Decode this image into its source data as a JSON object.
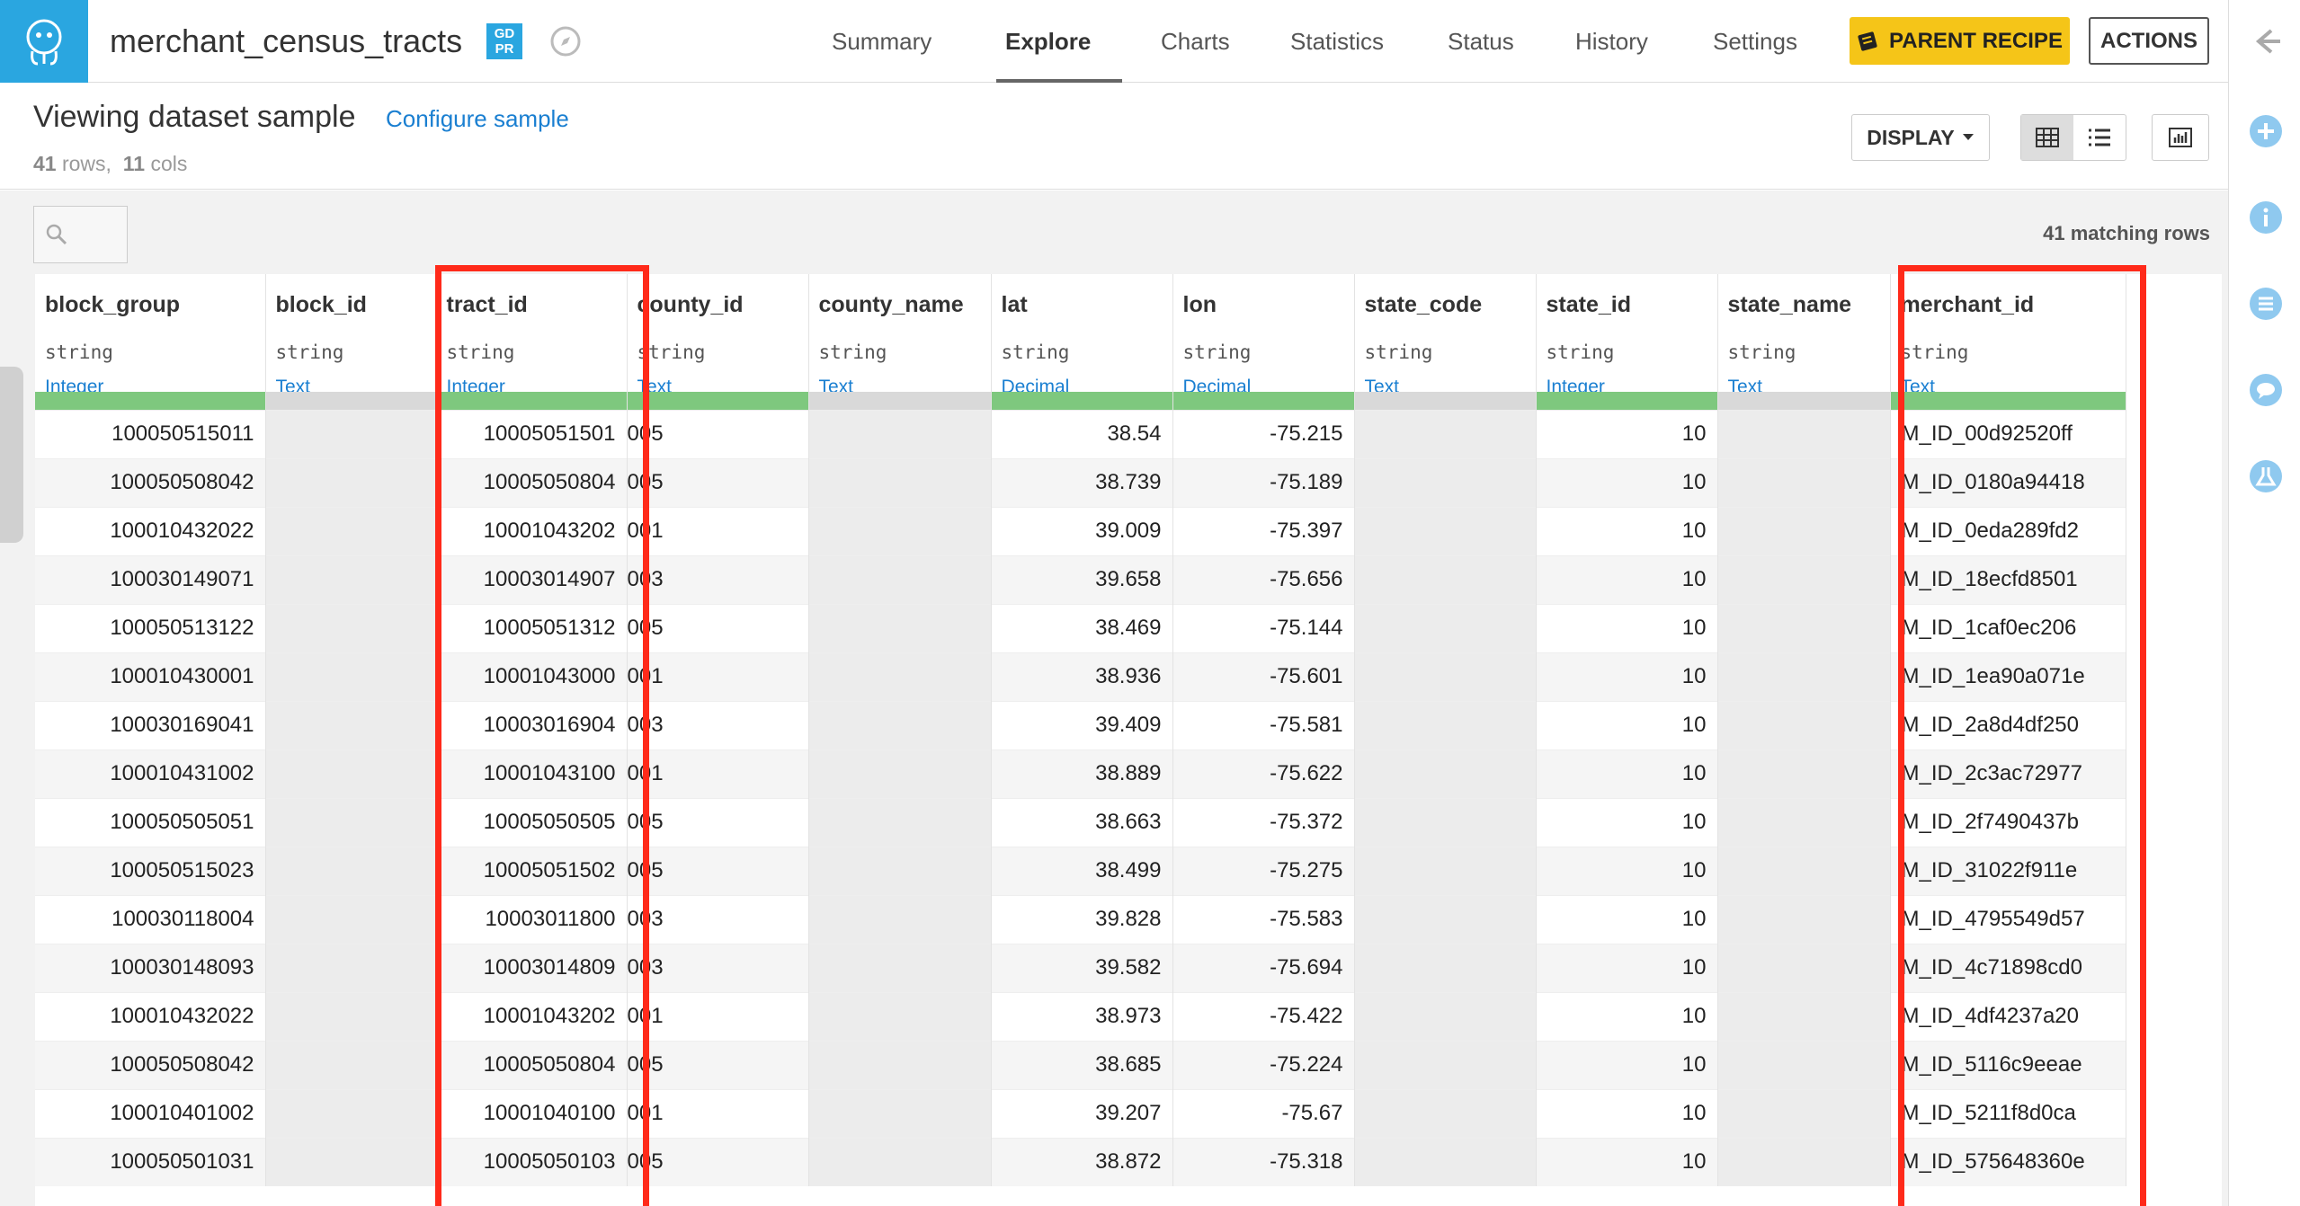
{
  "app": {
    "dataset_name": "merchant_census_tracts",
    "gdpr_badge": "GD PR"
  },
  "nav": {
    "tabs": [
      {
        "label": "Summary",
        "active": false
      },
      {
        "label": "Explore",
        "active": true
      },
      {
        "label": "Charts",
        "active": false
      },
      {
        "label": "Statistics",
        "active": false
      },
      {
        "label": "Status",
        "active": false
      },
      {
        "label": "History",
        "active": false
      },
      {
        "label": "Settings",
        "active": false
      }
    ],
    "parent_recipe_label": "PARENT RECIPE",
    "actions_label": "ACTIONS"
  },
  "subheader": {
    "title": "Viewing dataset sample",
    "configure_link": "Configure sample",
    "rows_count": "41",
    "rows_label": "rows,",
    "cols_count": "11",
    "cols_label": "cols",
    "display_label": "DISPLAY"
  },
  "grid": {
    "matching_rows": "41 matching rows",
    "columns": [
      {
        "name": "block_group",
        "type": "string",
        "meaning": "Integer",
        "bar": "green"
      },
      {
        "name": "block_id",
        "type": "string",
        "meaning": "Text",
        "bar": "gray"
      },
      {
        "name": "tract_id",
        "type": "string",
        "meaning": "Integer",
        "bar": "green"
      },
      {
        "name": "county_id",
        "type": "string",
        "meaning": "Text",
        "bar": "green"
      },
      {
        "name": "county_name",
        "type": "string",
        "meaning": "Text",
        "bar": "gray"
      },
      {
        "name": "lat",
        "type": "string",
        "meaning": "Decimal",
        "bar": "green"
      },
      {
        "name": "lon",
        "type": "string",
        "meaning": "Decimal",
        "bar": "green"
      },
      {
        "name": "state_code",
        "type": "string",
        "meaning": "Text",
        "bar": "gray"
      },
      {
        "name": "state_id",
        "type": "string",
        "meaning": "Integer",
        "bar": "green"
      },
      {
        "name": "state_name",
        "type": "string",
        "meaning": "Text",
        "bar": "gray"
      },
      {
        "name": "merchant_id",
        "type": "string",
        "meaning": "Text",
        "bar": "green"
      }
    ],
    "rows": [
      [
        "100050515011",
        "",
        "10005051501",
        "005",
        "",
        "38.54",
        "-75.215",
        "",
        "10",
        "",
        "M_ID_00d92520ff"
      ],
      [
        "100050508042",
        "",
        "10005050804",
        "005",
        "",
        "38.739",
        "-75.189",
        "",
        "10",
        "",
        "M_ID_0180a94418"
      ],
      [
        "100010432022",
        "",
        "10001043202",
        "001",
        "",
        "39.009",
        "-75.397",
        "",
        "10",
        "",
        "M_ID_0eda289fd2"
      ],
      [
        "100030149071",
        "",
        "10003014907",
        "003",
        "",
        "39.658",
        "-75.656",
        "",
        "10",
        "",
        "M_ID_18ecfd8501"
      ],
      [
        "100050513122",
        "",
        "10005051312",
        "005",
        "",
        "38.469",
        "-75.144",
        "",
        "10",
        "",
        "M_ID_1caf0ec206"
      ],
      [
        "100010430001",
        "",
        "10001043000",
        "001",
        "",
        "38.936",
        "-75.601",
        "",
        "10",
        "",
        "M_ID_1ea90a071e"
      ],
      [
        "100030169041",
        "",
        "10003016904",
        "003",
        "",
        "39.409",
        "-75.581",
        "",
        "10",
        "",
        "M_ID_2a8d4df250"
      ],
      [
        "100010431002",
        "",
        "10001043100",
        "001",
        "",
        "38.889",
        "-75.622",
        "",
        "10",
        "",
        "M_ID_2c3ac72977"
      ],
      [
        "100050505051",
        "",
        "10005050505",
        "005",
        "",
        "38.663",
        "-75.372",
        "",
        "10",
        "",
        "M_ID_2f7490437b"
      ],
      [
        "100050515023",
        "",
        "10005051502",
        "005",
        "",
        "38.499",
        "-75.275",
        "",
        "10",
        "",
        "M_ID_31022f911e"
      ],
      [
        "100030118004",
        "",
        "10003011800",
        "003",
        "",
        "39.828",
        "-75.583",
        "",
        "10",
        "",
        "M_ID_4795549d57"
      ],
      [
        "100030148093",
        "",
        "10003014809",
        "003",
        "",
        "39.582",
        "-75.694",
        "",
        "10",
        "",
        "M_ID_4c71898cd0"
      ],
      [
        "100010432022",
        "",
        "10001043202",
        "001",
        "",
        "38.973",
        "-75.422",
        "",
        "10",
        "",
        "M_ID_4df4237a20"
      ],
      [
        "100050508042",
        "",
        "10005050804",
        "005",
        "",
        "38.685",
        "-75.224",
        "",
        "10",
        "",
        "M_ID_5116c9eeae"
      ],
      [
        "100010401002",
        "",
        "10001040100",
        "001",
        "",
        "39.207",
        "-75.67",
        "",
        "10",
        "",
        "M_ID_5211f8d0ca"
      ],
      [
        "100050501031",
        "",
        "10005050103",
        "005",
        "",
        "38.872",
        "-75.318",
        "",
        "10",
        "",
        "M_ID_575648360e"
      ]
    ]
  },
  "colors": {
    "brand_blue": "#2aa6e0",
    "parent_recipe_yellow": "#f5c518",
    "link_blue": "#1a7fd1",
    "valid_green": "#7ec87e",
    "highlight_red": "#ff2a1a"
  }
}
